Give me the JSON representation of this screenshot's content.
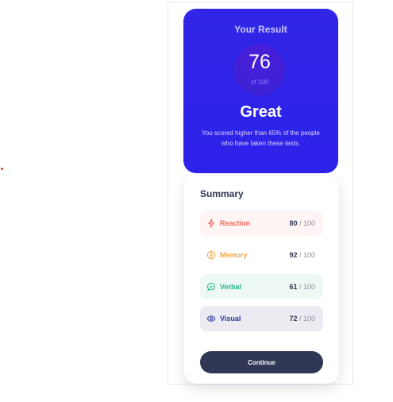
{
  "result": {
    "title": "Your Result",
    "score": "76",
    "score_total": "of 100",
    "rating": "Great",
    "description": "You scored higher than 65% of the people who have taken these tests."
  },
  "summary": {
    "title": "Summary",
    "items": [
      {
        "label": "Reaction",
        "score": "80",
        "max": " / 100",
        "icon": "lightning-icon",
        "color": "#f46b5d"
      },
      {
        "label": "Memory",
        "score": "92",
        "max": " / 100",
        "icon": "brain-icon",
        "color": "#f2a641"
      },
      {
        "label": "Verbal",
        "score": "61",
        "max": " / 100",
        "icon": "chat-bubble-icon",
        "color": "#1fb889"
      },
      {
        "label": "Visual",
        "score": "72",
        "max": " / 100",
        "icon": "eye-icon",
        "color": "#2e36a7"
      }
    ]
  },
  "actions": {
    "continue_label": "Continue"
  }
}
